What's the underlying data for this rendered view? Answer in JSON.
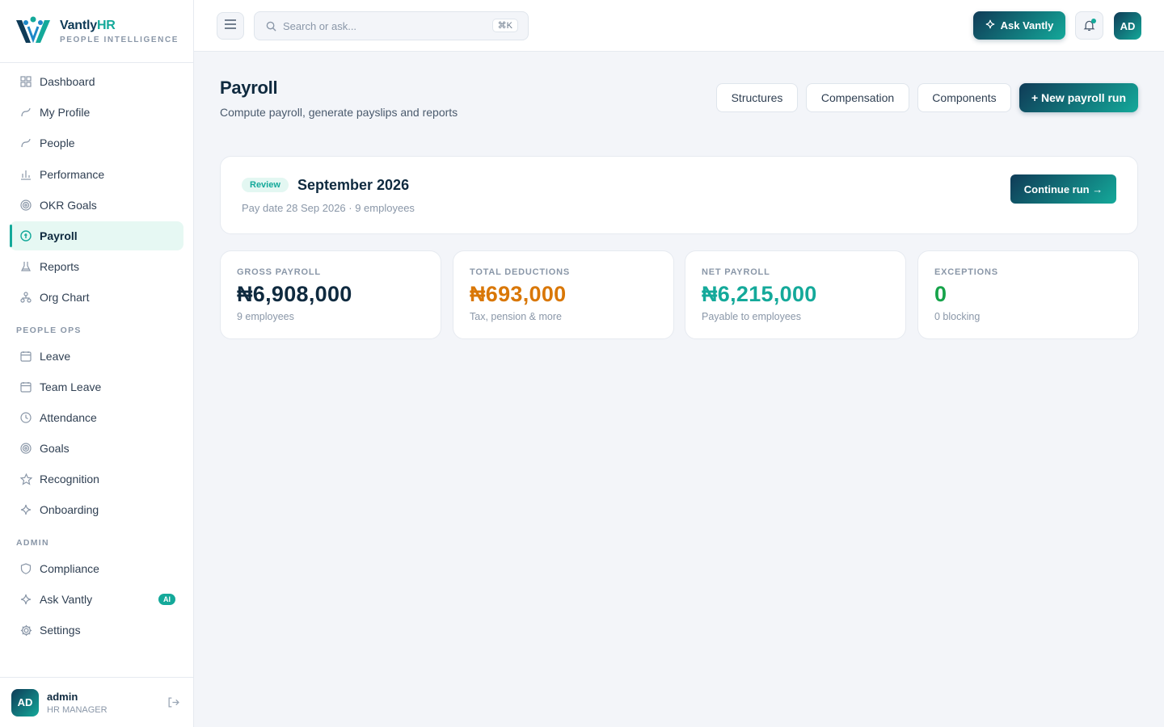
{
  "brand": {
    "name": "Vantly",
    "name_suffix": "HR",
    "tagline": "PEOPLE INTELLIGENCE"
  },
  "sidebar": {
    "items": [
      {
        "label": "Dashboard",
        "icon": "grid-icon"
      },
      {
        "label": "My Profile",
        "icon": "user-icon"
      },
      {
        "label": "People",
        "icon": "users-icon"
      },
      {
        "label": "Performance",
        "icon": "bar-chart-icon"
      },
      {
        "label": "OKR Goals",
        "icon": "target-icon"
      },
      {
        "label": "Payroll",
        "icon": "money-icon",
        "active": true
      },
      {
        "label": "Reports",
        "icon": "flask-icon"
      },
      {
        "label": "Org Chart",
        "icon": "org-chart-icon"
      }
    ],
    "section_people_ops": "PEOPLE OPS",
    "people_ops_items": [
      {
        "label": "Leave",
        "icon": "calendar-icon"
      },
      {
        "label": "Team Leave",
        "icon": "calendar-icon"
      },
      {
        "label": "Attendance",
        "icon": "clock-icon"
      },
      {
        "label": "Goals",
        "icon": "target-icon"
      },
      {
        "label": "Recognition",
        "icon": "star-icon"
      },
      {
        "label": "Onboarding",
        "icon": "sparkle-icon"
      }
    ],
    "section_admin": "ADMIN",
    "admin_items": [
      {
        "label": "Compliance",
        "icon": "shield-icon"
      },
      {
        "label": "Ask Vantly",
        "icon": "sparkle-icon",
        "badge": "AI"
      },
      {
        "label": "Settings",
        "icon": "gear-icon"
      }
    ],
    "user": {
      "initials": "AD",
      "name": "admin",
      "role": "HR MANAGER"
    }
  },
  "topbar": {
    "search_placeholder": "Search or ask...",
    "search_shortcut": "⌘K",
    "ask_label": "Ask Vantly",
    "avatar_initials": "AD"
  },
  "page": {
    "title": "Payroll",
    "subtitle": "Compute payroll, generate payslips and reports",
    "buttons": {
      "structures": "Structures",
      "compensation": "Compensation",
      "components": "Components",
      "new_run": "+ New payroll run"
    }
  },
  "run": {
    "status": "Review",
    "title": "September 2026",
    "meta": "Pay date 28 Sep 2026 · 9 employees",
    "continue_label": "Continue run →"
  },
  "stats": [
    {
      "label": "GROSS PAYROLL",
      "value": "₦6,908,000",
      "note": "9 employees",
      "color": "#0f2a3f"
    },
    {
      "label": "TOTAL DEDUCTIONS",
      "value": "₦693,000",
      "note": "Tax, pension & more",
      "color": "#d97706"
    },
    {
      "label": "NET PAYROLL",
      "value": "₦6,215,000",
      "note": "Payable to employees",
      "color": "#14a99a"
    },
    {
      "label": "EXCEPTIONS",
      "value": "0",
      "note": "0 blocking",
      "color": "#16a34a"
    }
  ],
  "colors": {
    "accent": "#14a99a",
    "brand_dark": "#0f3b57"
  }
}
